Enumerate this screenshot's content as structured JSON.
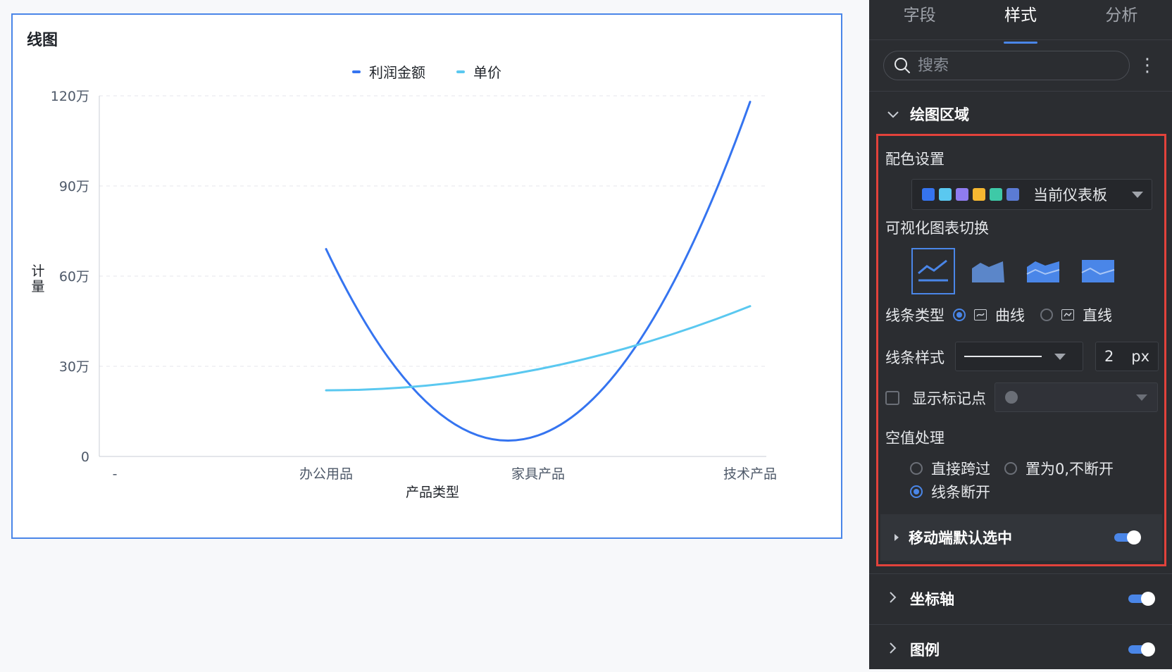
{
  "chart_card": {
    "title": "线图",
    "legend": [
      {
        "label": "利润金额",
        "color": "#3574f0"
      },
      {
        "label": "单价",
        "color": "#5ac8f0"
      }
    ]
  },
  "chart_data": {
    "type": "line",
    "title": "线图",
    "categories": [
      "-",
      "办公用品",
      "家具产品",
      "技术产品"
    ],
    "series": [
      {
        "name": "利润金额",
        "values": [
          null,
          690000,
          70000,
          1180000
        ],
        "color": "#3574f0"
      },
      {
        "name": "单价",
        "values": [
          null,
          220000,
          290000,
          500000
        ],
        "color": "#5ac8f0"
      }
    ],
    "xlabel": "产品类型",
    "ylabel": "计量",
    "ylim": [
      0,
      1200000
    ],
    "yticks": [
      0,
      300000,
      600000,
      900000,
      1200000
    ],
    "ytick_labels": [
      "0",
      "30万",
      "60万",
      "90万",
      "120万"
    ],
    "smooth": true,
    "grid": true,
    "legend_position": "top"
  },
  "panel": {
    "tabs": [
      {
        "label": "字段",
        "active": false
      },
      {
        "label": "样式",
        "active": true
      },
      {
        "label": "分析",
        "active": false
      }
    ],
    "search": {
      "placeholder": "搜索"
    },
    "plot_area": {
      "title": "绘图区域",
      "color_setting": {
        "label": "配色设置",
        "swatches": [
          "#3574f0",
          "#5ac8f0",
          "#8f7cf0",
          "#f5b731",
          "#3ec9a7",
          "#5b7bd4"
        ],
        "value": "当前仪表板"
      },
      "chart_switch": {
        "label": "可视化图表切换"
      },
      "line_type": {
        "label": "线条类型",
        "options": [
          {
            "label": "曲线",
            "selected": true
          },
          {
            "label": "直线",
            "selected": false
          }
        ]
      },
      "line_style": {
        "label": "线条样式",
        "width": "2",
        "unit": "px"
      },
      "show_markers": {
        "label": "显示标记点",
        "checked": false
      },
      "null_handling": {
        "label": "空值处理",
        "options": [
          {
            "label": "直接跨过",
            "selected": false
          },
          {
            "label": "置为0,不断开",
            "selected": false
          },
          {
            "label": "线条断开",
            "selected": true
          }
        ]
      },
      "mobile_default": {
        "label": "移动端默认选中",
        "enabled": true
      }
    },
    "axis": {
      "label": "坐标轴",
      "enabled": true
    },
    "legend": {
      "label": "图例",
      "enabled": true
    }
  }
}
